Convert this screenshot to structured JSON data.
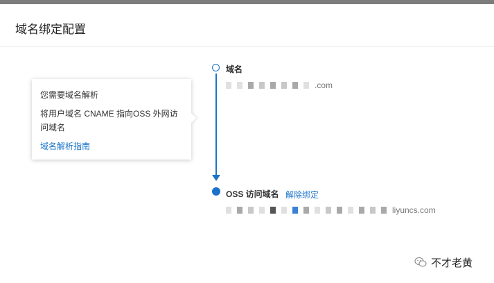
{
  "page": {
    "title": "域名绑定配置"
  },
  "tooltip": {
    "title": "您需要域名解析",
    "description": "将用户域名 CNAME 指向OSS 外网访问域名",
    "link_label": "域名解析指南"
  },
  "steps": {
    "domain": {
      "label": "域名",
      "value_suffix": ".com"
    },
    "oss": {
      "label": "OSS 访问域名",
      "action_label": "解除绑定",
      "value_suffix": "liyuncs.com"
    }
  },
  "watermark": {
    "text": "不才老黄"
  },
  "colors": {
    "accent": "#1a73c8",
    "top_bar": "#7d7d7d"
  }
}
